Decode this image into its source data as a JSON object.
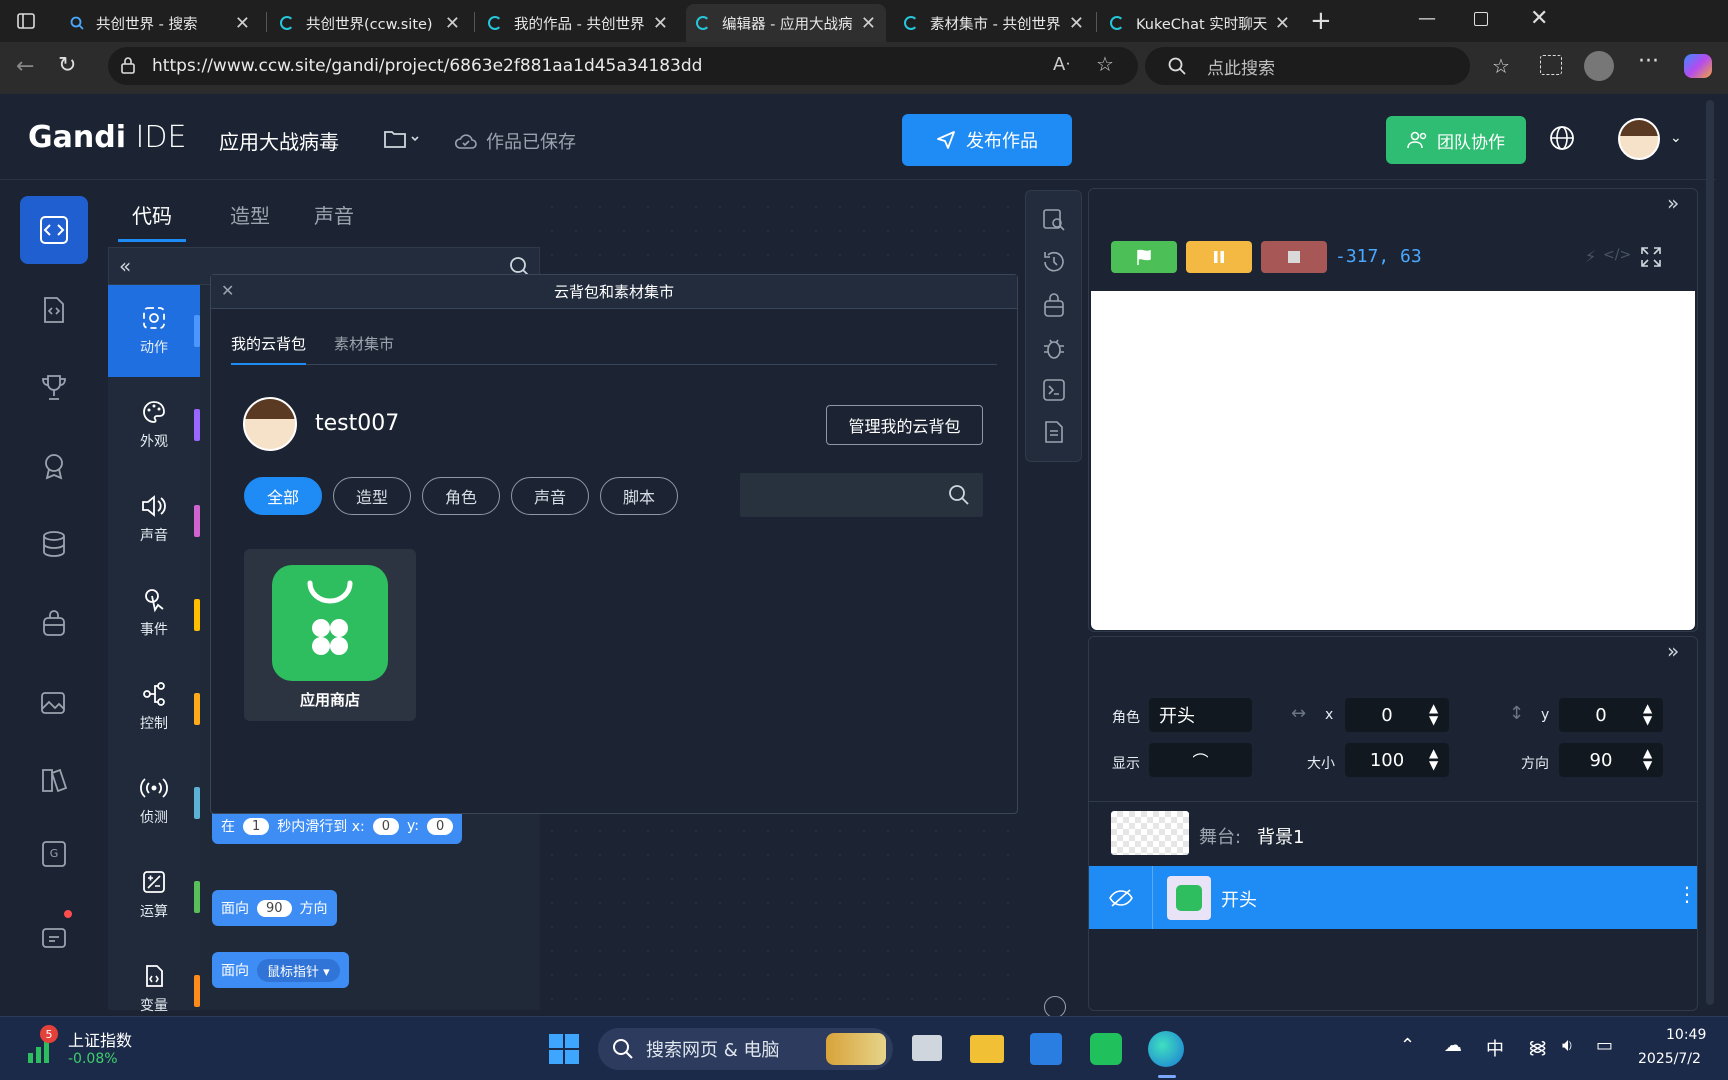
{
  "browser": {
    "tabs": [
      {
        "label": "共创世界 - 搜索",
        "icon": "search-icon"
      },
      {
        "label": "共创世界(ccw.site) -",
        "icon": "ccw-icon"
      },
      {
        "label": "我的作品 - 共创世界",
        "icon": "ccw-icon"
      },
      {
        "label": "编辑器 - 应用大战病",
        "icon": "ccw-icon"
      },
      {
        "label": "素材集市 - 共创世界",
        "icon": "ccw-icon"
      },
      {
        "label": "KukeChat 实时聊天",
        "icon": "ccw-icon"
      }
    ],
    "url": "https://www.ccw.site/gandi/project/6863e2f881aa1d45a34183dd",
    "search_placeholder": "点此搜索"
  },
  "ide": {
    "logo_bold": "Gandi",
    "logo_thin": "IDE",
    "project_title": "应用大战病毒",
    "save_status": "作品已保存",
    "publish_label": "发布作品",
    "team_label": "团队协作"
  },
  "editor_tabs": [
    "代码",
    "造型",
    "声音"
  ],
  "categories": [
    {
      "label": "动作",
      "color": "#4c97ff"
    },
    {
      "label": "外观",
      "color": "#9966ff"
    },
    {
      "label": "声音",
      "color": "#cf63cf"
    },
    {
      "label": "事件",
      "color": "#ffbf00"
    },
    {
      "label": "控制",
      "color": "#ffab19"
    },
    {
      "label": "侦测",
      "color": "#5cb1d6"
    },
    {
      "label": "运算",
      "color": "#59c059"
    },
    {
      "label": "变量",
      "color": "#ff8c1a"
    }
  ],
  "blocks": {
    "glide": {
      "prefix": "在",
      "secs": "1",
      "mid": "秒内滑行到 x:",
      "x": "0",
      "ylabel": "y:",
      "y": "0"
    },
    "point": {
      "prefix": "面向",
      "value": "90",
      "suffix": "方向"
    },
    "point_towards": {
      "prefix": "面向",
      "target": "鼠标指针"
    }
  },
  "modal": {
    "title": "云背包和素材集市",
    "tabs": [
      "我的云背包",
      "素材集市"
    ],
    "username": "test007",
    "manage_label": "管理我的云背包",
    "filters": [
      "全部",
      "造型",
      "角色",
      "声音",
      "脚本"
    ],
    "item": {
      "name": "应用商店"
    }
  },
  "stage": {
    "coords": "-317, 63",
    "colors": {
      "flag": "#4cbf56",
      "pause": "#f4b942",
      "stop": "#a85757"
    }
  },
  "sprite": {
    "role_label": "角色",
    "role_name": "开头",
    "x_label": "x",
    "x": "0",
    "y_label": "y",
    "y": "0",
    "show_label": "显示",
    "size_label": "大小",
    "size": "100",
    "dir_label": "方向",
    "direction": "90",
    "stage_label": "舞台:",
    "backdrop": "背景1",
    "selected_sprite": "开头"
  },
  "taskbar": {
    "stock_name": "上证指数",
    "stock_change": "-0.08%",
    "badge": "5",
    "search_label": "搜索网页 & 电脑",
    "ime": "中",
    "time": "10:49",
    "date": "2025/7/2"
  }
}
